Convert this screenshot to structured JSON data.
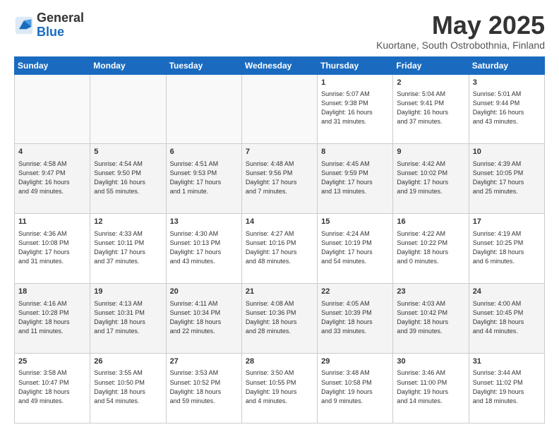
{
  "logo": {
    "general": "General",
    "blue": "Blue"
  },
  "title": {
    "month": "May 2025",
    "location": "Kuortane, South Ostrobothnia, Finland"
  },
  "weekdays": [
    "Sunday",
    "Monday",
    "Tuesday",
    "Wednesday",
    "Thursday",
    "Friday",
    "Saturday"
  ],
  "weeks": [
    [
      {
        "day": "",
        "info": ""
      },
      {
        "day": "",
        "info": ""
      },
      {
        "day": "",
        "info": ""
      },
      {
        "day": "",
        "info": ""
      },
      {
        "day": "1",
        "info": "Sunrise: 5:07 AM\nSunset: 9:38 PM\nDaylight: 16 hours\nand 31 minutes."
      },
      {
        "day": "2",
        "info": "Sunrise: 5:04 AM\nSunset: 9:41 PM\nDaylight: 16 hours\nand 37 minutes."
      },
      {
        "day": "3",
        "info": "Sunrise: 5:01 AM\nSunset: 9:44 PM\nDaylight: 16 hours\nand 43 minutes."
      }
    ],
    [
      {
        "day": "4",
        "info": "Sunrise: 4:58 AM\nSunset: 9:47 PM\nDaylight: 16 hours\nand 49 minutes."
      },
      {
        "day": "5",
        "info": "Sunrise: 4:54 AM\nSunset: 9:50 PM\nDaylight: 16 hours\nand 55 minutes."
      },
      {
        "day": "6",
        "info": "Sunrise: 4:51 AM\nSunset: 9:53 PM\nDaylight: 17 hours\nand 1 minute."
      },
      {
        "day": "7",
        "info": "Sunrise: 4:48 AM\nSunset: 9:56 PM\nDaylight: 17 hours\nand 7 minutes."
      },
      {
        "day": "8",
        "info": "Sunrise: 4:45 AM\nSunset: 9:59 PM\nDaylight: 17 hours\nand 13 minutes."
      },
      {
        "day": "9",
        "info": "Sunrise: 4:42 AM\nSunset: 10:02 PM\nDaylight: 17 hours\nand 19 minutes."
      },
      {
        "day": "10",
        "info": "Sunrise: 4:39 AM\nSunset: 10:05 PM\nDaylight: 17 hours\nand 25 minutes."
      }
    ],
    [
      {
        "day": "11",
        "info": "Sunrise: 4:36 AM\nSunset: 10:08 PM\nDaylight: 17 hours\nand 31 minutes."
      },
      {
        "day": "12",
        "info": "Sunrise: 4:33 AM\nSunset: 10:11 PM\nDaylight: 17 hours\nand 37 minutes."
      },
      {
        "day": "13",
        "info": "Sunrise: 4:30 AM\nSunset: 10:13 PM\nDaylight: 17 hours\nand 43 minutes."
      },
      {
        "day": "14",
        "info": "Sunrise: 4:27 AM\nSunset: 10:16 PM\nDaylight: 17 hours\nand 48 minutes."
      },
      {
        "day": "15",
        "info": "Sunrise: 4:24 AM\nSunset: 10:19 PM\nDaylight: 17 hours\nand 54 minutes."
      },
      {
        "day": "16",
        "info": "Sunrise: 4:22 AM\nSunset: 10:22 PM\nDaylight: 18 hours\nand 0 minutes."
      },
      {
        "day": "17",
        "info": "Sunrise: 4:19 AM\nSunset: 10:25 PM\nDaylight: 18 hours\nand 6 minutes."
      }
    ],
    [
      {
        "day": "18",
        "info": "Sunrise: 4:16 AM\nSunset: 10:28 PM\nDaylight: 18 hours\nand 11 minutes."
      },
      {
        "day": "19",
        "info": "Sunrise: 4:13 AM\nSunset: 10:31 PM\nDaylight: 18 hours\nand 17 minutes."
      },
      {
        "day": "20",
        "info": "Sunrise: 4:11 AM\nSunset: 10:34 PM\nDaylight: 18 hours\nand 22 minutes."
      },
      {
        "day": "21",
        "info": "Sunrise: 4:08 AM\nSunset: 10:36 PM\nDaylight: 18 hours\nand 28 minutes."
      },
      {
        "day": "22",
        "info": "Sunrise: 4:05 AM\nSunset: 10:39 PM\nDaylight: 18 hours\nand 33 minutes."
      },
      {
        "day": "23",
        "info": "Sunrise: 4:03 AM\nSunset: 10:42 PM\nDaylight: 18 hours\nand 39 minutes."
      },
      {
        "day": "24",
        "info": "Sunrise: 4:00 AM\nSunset: 10:45 PM\nDaylight: 18 hours\nand 44 minutes."
      }
    ],
    [
      {
        "day": "25",
        "info": "Sunrise: 3:58 AM\nSunset: 10:47 PM\nDaylight: 18 hours\nand 49 minutes."
      },
      {
        "day": "26",
        "info": "Sunrise: 3:55 AM\nSunset: 10:50 PM\nDaylight: 18 hours\nand 54 minutes."
      },
      {
        "day": "27",
        "info": "Sunrise: 3:53 AM\nSunset: 10:52 PM\nDaylight: 18 hours\nand 59 minutes."
      },
      {
        "day": "28",
        "info": "Sunrise: 3:50 AM\nSunset: 10:55 PM\nDaylight: 19 hours\nand 4 minutes."
      },
      {
        "day": "29",
        "info": "Sunrise: 3:48 AM\nSunset: 10:58 PM\nDaylight: 19 hours\nand 9 minutes."
      },
      {
        "day": "30",
        "info": "Sunrise: 3:46 AM\nSunset: 11:00 PM\nDaylight: 19 hours\nand 14 minutes."
      },
      {
        "day": "31",
        "info": "Sunrise: 3:44 AM\nSunset: 11:02 PM\nDaylight: 19 hours\nand 18 minutes."
      }
    ]
  ]
}
